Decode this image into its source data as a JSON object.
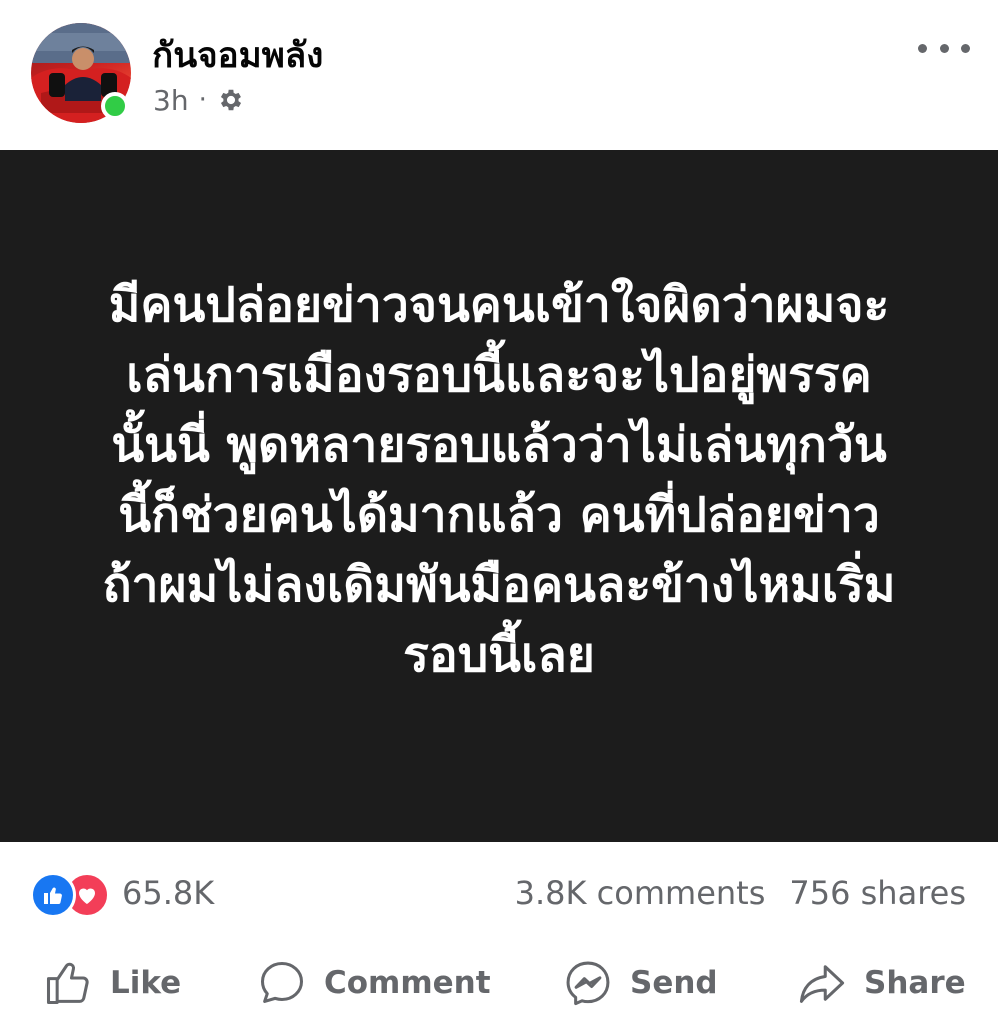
{
  "post": {
    "author": "กันจอมพลัง",
    "time": "3h",
    "separator": "·",
    "privacy_icon": "gear-icon",
    "text_lines": [
      "มีคนปล่อยข่าวจนคนเข้าใจผิดว่าผมจะ",
      "เล่นการเมืองรอบนี้และจะไปอยู่พรรค",
      "นั้นนี่ พูดหลายรอบแล้วว่าไม่เล่นทุกวัน",
      "นี้ก็ช่วยคนได้มากแล้ว คนที่ปล่อยข่าว",
      "ถ้าผมไม่ลงเดิมพันมือคนละข้างไหมเริ่ม",
      "รอบนี้เลย"
    ]
  },
  "stats": {
    "reactions_count": "65.8K",
    "comments": "3.8K comments",
    "shares": "756 shares"
  },
  "actions": {
    "like": "Like",
    "comment": "Comment",
    "send": "Send",
    "share": "Share"
  },
  "colors": {
    "post_background": "#1c1c1c",
    "like_blue": "#1877f2",
    "love_red": "#f33e58",
    "online_green": "#31cc46",
    "secondary_text": "#65676b"
  }
}
